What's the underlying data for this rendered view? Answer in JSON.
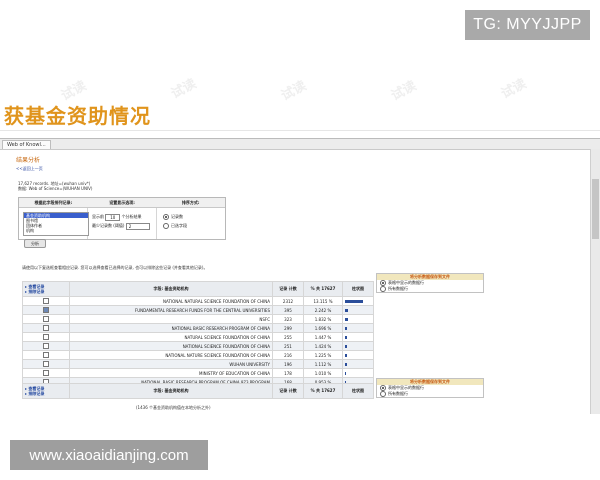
{
  "header_badge": "TG: MYYJJPP",
  "slide_title": "获基金资助情况",
  "footer_badge": "www.xiaoaidianjing.com",
  "watermark_text": "试读",
  "browser_tab": "Web of Knowl...",
  "analysis": {
    "section_title": "结果分析",
    "back_link": "<<返回上一页",
    "records_line": "17,627 records. 地址=(wuhan univ*)",
    "database_line": "数据: Web of Science=(WUHAN UNIV)",
    "param_headers": [
      "根据此字段排列记录:",
      "设置显示选项:",
      "排序方式:"
    ],
    "field_list": [
      "基金资助机构",
      "图书馆",
      "团体作者",
      "机构"
    ],
    "display_show_label": "显示前",
    "display_show_value": "10",
    "display_show_suffix": "个分析结果",
    "display_min_label": "最少记录数 (阈值)",
    "display_min_value": "2",
    "sort_options": [
      "记录数",
      "已选字段"
    ],
    "analyze_button": "分析"
  },
  "instruction": "请使用以下复选框查看相应记录. 您可以选择查看已选择的记录, 也可以排除这些记录 (并查看其他记录)。",
  "save_panel": {
    "title": "将分析数据保存到文件",
    "options": [
      "表格中显示的数据行",
      "所有数据行"
    ]
  },
  "results_table": {
    "action_view": "查看记录",
    "action_exclude": "排除记录",
    "headers": [
      "字段: 基金资助机构",
      "记录 计数",
      "% 共 17627",
      "柱状图"
    ],
    "rows": [
      {
        "name": "NATIONAL NATURAL SCIENCE FOUNDATION OF CHINA",
        "count": "2312",
        "pct": "13.115 %",
        "checked": false,
        "bar": 1.0
      },
      {
        "name": "FUNDAMENTAL RESEARCH FUNDS FOR THE CENTRAL UNIVERSITIES",
        "count": "395",
        "pct": "2.242 %",
        "checked": true,
        "bar": 0.17
      },
      {
        "name": "NSFC",
        "count": "323",
        "pct": "1.832 %",
        "checked": false,
        "bar": 0.14
      },
      {
        "name": "NATIONAL BASIC RESEARCH PROGRAM OF CHINA",
        "count": "299",
        "pct": "1.696 %",
        "checked": false,
        "bar": 0.13
      },
      {
        "name": "NATURAL SCIENCE FOUNDATION OF CHINA",
        "count": "255",
        "pct": "1.447 %",
        "checked": false,
        "bar": 0.11
      },
      {
        "name": "NATIONAL SCIENCE FOUNDATION OF CHINA",
        "count": "251",
        "pct": "1.424 %",
        "checked": false,
        "bar": 0.11
      },
      {
        "name": "NATIONAL NATURE SCIENCE FOUNDATION OF CHINA",
        "count": "216",
        "pct": "1.225 %",
        "checked": false,
        "bar": 0.09
      },
      {
        "name": "WUHAN UNIVERSITY",
        "count": "196",
        "pct": "1.112 %",
        "checked": false,
        "bar": 0.085
      },
      {
        "name": "MINISTRY OF EDUCATION OF CHINA",
        "count": "178",
        "pct": "1.010 %",
        "checked": false,
        "bar": 0.08
      },
      {
        "name": "NATIONAL BASIC RESEARCH PROGRAM OF CHINA 973 PROGRAM",
        "count": "168",
        "pct": "0.953 %",
        "checked": false,
        "bar": 0.075
      }
    ],
    "footer_note": "(1436 个基金资助机构值在本地分析之外)"
  }
}
